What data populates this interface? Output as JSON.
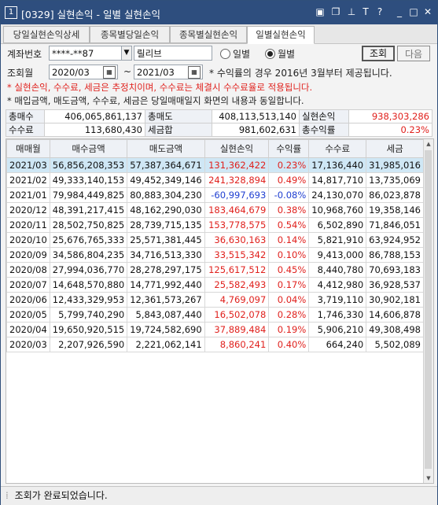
{
  "window": {
    "number": "1",
    "title": "[0329] 실현손익 - 일별 실현손익",
    "buttons": [
      "⧉",
      "⧉",
      "⊥",
      "T",
      "?",
      "_",
      "□",
      "✕"
    ]
  },
  "tabs": [
    "당일실현손익상세",
    "종목별당일손익",
    "종목별실현손익",
    "일별실현손익"
  ],
  "active_tab": 3,
  "account": {
    "label": "계좌번호",
    "number": "****-**87",
    "name": "릴리브"
  },
  "period_mode": {
    "options": [
      "일별",
      "월별"
    ],
    "selected": "월별"
  },
  "buttons": {
    "search": "조회",
    "next": "다음"
  },
  "query_month": {
    "label": "조회월",
    "from": "2020/03",
    "separator": "~",
    "to": "2021/03",
    "note": "* 수익률의 경우 2016년 3월부터 제공됩니다."
  },
  "notices": [
    {
      "text": "* 실현손익, 수수료, 세금은 추정치이며, 수수료는 체결시 수수료율로 적용됩니다.",
      "color": "#e0211d"
    },
    {
      "text": "* 매입금액, 매도금액, 수수료, 세금은 당일매매일지 화면의 내용과 동일합니다.",
      "color": "#222222"
    }
  ],
  "summary": [
    [
      {
        "label": "총매수",
        "value": "406,065,861,137"
      },
      {
        "label": "총매도",
        "value": "408,113,513,140"
      },
      {
        "label": "실현손익",
        "value": "938,303,286",
        "color": "#e0211d"
      }
    ],
    [
      {
        "label": "수수료",
        "value": "113,680,430"
      },
      {
        "label": "세금합",
        "value": "981,602,631"
      },
      {
        "label": "총수익률",
        "value": "0.23%",
        "color": "#e0211d"
      }
    ]
  ],
  "table": {
    "columns": [
      "매매월",
      "매수금액",
      "매도금액",
      "실현손익",
      "수익률",
      "수수료",
      "세금"
    ],
    "rows": [
      [
        "2021/03",
        "56,856,208,353",
        "57,387,364,671",
        "131,362,422",
        "0.23%",
        "17,136,440",
        "31,985,016"
      ],
      [
        "2021/02",
        "49,333,140,153",
        "49,452,349,146",
        "241,328,894",
        "0.49%",
        "14,817,710",
        "13,735,069"
      ],
      [
        "2021/01",
        "79,984,449,825",
        "80,883,304,230",
        "-60,997,693",
        "-0.08%",
        "24,130,070",
        "86,023,878"
      ],
      [
        "2020/12",
        "48,391,217,415",
        "48,162,290,030",
        "183,464,679",
        "0.38%",
        "10,968,760",
        "19,358,146"
      ],
      [
        "2020/11",
        "28,502,750,825",
        "28,739,715,135",
        "153,778,575",
        "0.54%",
        "6,502,890",
        "71,846,051"
      ],
      [
        "2020/10",
        "25,676,765,333",
        "25,571,381,445",
        "36,630,163",
        "0.14%",
        "5,821,910",
        "63,924,952"
      ],
      [
        "2020/09",
        "34,586,804,235",
        "34,716,513,330",
        "33,515,342",
        "0.10%",
        "9,413,000",
        "86,788,153"
      ],
      [
        "2020/08",
        "27,994,036,770",
        "28,278,297,175",
        "125,617,512",
        "0.45%",
        "8,440,780",
        "70,693,183"
      ],
      [
        "2020/07",
        "14,648,570,880",
        "14,771,992,440",
        "25,582,493",
        "0.17%",
        "4,412,980",
        "36,928,537"
      ],
      [
        "2020/06",
        "12,433,329,953",
        "12,361,573,267",
        "4,769,097",
        "0.04%",
        "3,719,110",
        "30,902,181"
      ],
      [
        "2020/05",
        "5,799,740,290",
        "5,843,087,440",
        "16,502,078",
        "0.28%",
        "1,746,330",
        "14,606,878"
      ],
      [
        "2020/04",
        "19,650,920,515",
        "19,724,582,690",
        "37,889,484",
        "0.19%",
        "5,906,210",
        "49,308,498"
      ],
      [
        "2020/03",
        "2,207,926,590",
        "2,221,062,141",
        "8,860,241",
        "0.40%",
        "664,240",
        "5,502,089"
      ]
    ],
    "selected_row": 0
  },
  "status": "조회가 완료되었습니다."
}
